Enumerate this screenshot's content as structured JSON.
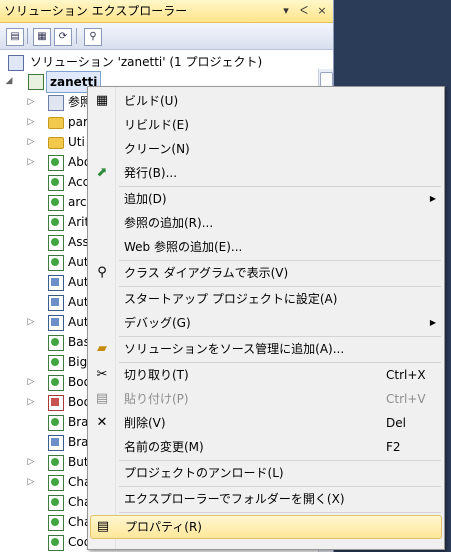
{
  "panel": {
    "title": "ソリューション エクスプローラー",
    "title_buttons": [
      "▾",
      "ᐸ",
      "×"
    ]
  },
  "toolbar": {
    "icons": [
      "properties-icon",
      "show-all-files-icon",
      "refresh-icon",
      "class-diagram-icon"
    ]
  },
  "tree": {
    "solution_label": "ソリューション 'zanetti' (1 プロジェクト)",
    "project_label": "zanetti",
    "items": [
      {
        "label": "参照",
        "icon": "refs",
        "expand": "▷"
      },
      {
        "label": "par",
        "icon": "folder",
        "expand": "▷"
      },
      {
        "label": "Uti",
        "icon": "folder",
        "expand": "▷"
      },
      {
        "label": "Abo",
        "icon": "form",
        "expand": "▷"
      },
      {
        "label": "Acc",
        "icon": "form",
        "expand": ""
      },
      {
        "label": "arc",
        "icon": "form",
        "expand": ""
      },
      {
        "label": "Arit",
        "icon": "form",
        "expand": ""
      },
      {
        "label": "Ass",
        "icon": "form",
        "expand": ""
      },
      {
        "label": "Aut",
        "icon": "form",
        "expand": ""
      },
      {
        "label": "Aut",
        "icon": "cls",
        "expand": ""
      },
      {
        "label": "Aut",
        "icon": "cls",
        "expand": ""
      },
      {
        "label": "Aut",
        "icon": "cls",
        "expand": "▷"
      },
      {
        "label": "Bas",
        "icon": "form",
        "expand": ""
      },
      {
        "label": "Big",
        "icon": "form",
        "expand": ""
      },
      {
        "label": "Boo",
        "icon": "form",
        "expand": "▷"
      },
      {
        "label": "Boo",
        "icon": "red",
        "expand": "▷"
      },
      {
        "label": "Bra",
        "icon": "form",
        "expand": ""
      },
      {
        "label": "Bra",
        "icon": "cls",
        "expand": ""
      },
      {
        "label": "But",
        "icon": "form",
        "expand": "▷"
      },
      {
        "label": "Cha",
        "icon": "form",
        "expand": "▷"
      },
      {
        "label": "Cha",
        "icon": "form",
        "expand": ""
      },
      {
        "label": "Cha",
        "icon": "form",
        "expand": ""
      },
      {
        "label": "CodeBoxes",
        "icon": "form",
        "expand": ""
      }
    ]
  },
  "context_menu": {
    "build": "ビルド(U)",
    "rebuild": "リビルド(E)",
    "clean": "クリーン(N)",
    "publish": "発行(B)...",
    "add": "追加(D)",
    "add_reference": "参照の追加(R)...",
    "add_web_reference": "Web 参照の追加(E)...",
    "view_class_diagram": "クラス ダイアグラムで表示(V)",
    "set_startup": "スタートアップ プロジェクトに設定(A)",
    "debug": "デバッグ(G)",
    "add_source_control": "ソリューションをソース管理に追加(A)...",
    "cut": "切り取り(T)",
    "cut_shortcut": "Ctrl+X",
    "paste": "貼り付け(P)",
    "paste_shortcut": "Ctrl+V",
    "delete": "削除(V)",
    "delete_shortcut": "Del",
    "rename": "名前の変更(M)",
    "rename_shortcut": "F2",
    "unload_project": "プロジェクトのアンロード(L)",
    "open_folder": "エクスプローラーでフォルダーを開く(X)",
    "properties": "プロパティ(R)"
  }
}
